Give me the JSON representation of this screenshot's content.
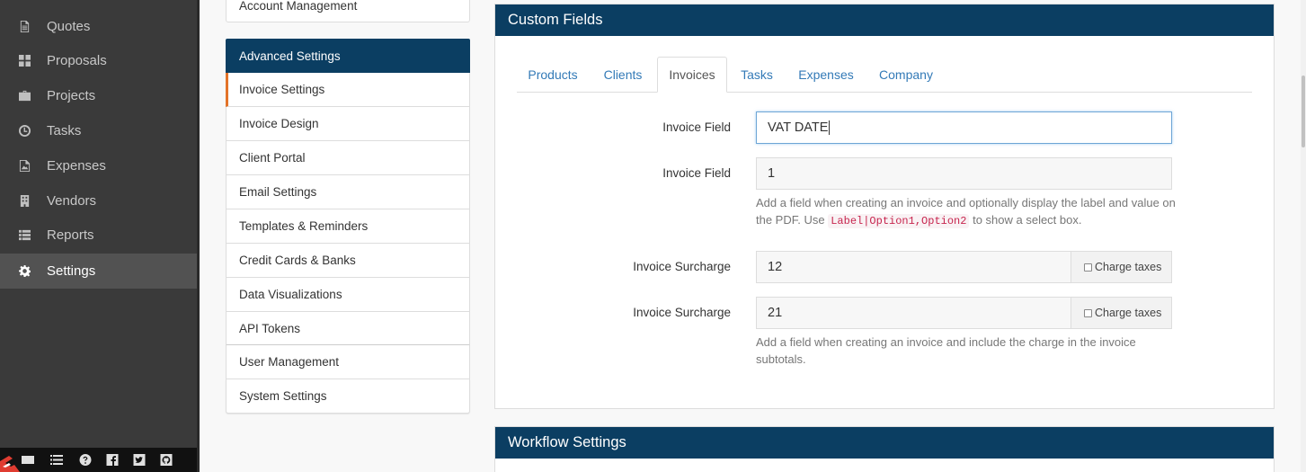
{
  "sidebar": {
    "items": [
      {
        "label": "Quotes",
        "icon": "file-icon"
      },
      {
        "label": "Proposals",
        "icon": "grid-icon"
      },
      {
        "label": "Projects",
        "icon": "briefcase-icon"
      },
      {
        "label": "Tasks",
        "icon": "clock-icon"
      },
      {
        "label": "Expenses",
        "icon": "image-icon"
      },
      {
        "label": "Vendors",
        "icon": "building-icon"
      },
      {
        "label": "Reports",
        "icon": "list-icon"
      },
      {
        "label": "Settings",
        "icon": "gear-icon",
        "active": true
      }
    ],
    "footer_icons": [
      "mail-icon",
      "list-icon",
      "help-icon",
      "facebook-icon",
      "twitter-icon",
      "github-icon"
    ]
  },
  "settings_nav": {
    "account_management": "Account Management",
    "advanced_header": "Advanced Settings",
    "items": [
      "Invoice Settings",
      "Invoice Design",
      "Client Portal",
      "Email Settings",
      "Templates & Reminders",
      "Credit Cards & Banks",
      "Data Visualizations",
      "API Tokens"
    ],
    "selected": "Invoice Settings",
    "admin_items": [
      "User Management",
      "System Settings"
    ]
  },
  "custom_fields": {
    "title": "Custom Fields",
    "tabs": [
      "Products",
      "Clients",
      "Invoices",
      "Tasks",
      "Expenses",
      "Company"
    ],
    "active_tab": "Invoices",
    "invoice_field_label_1": "Invoice Field",
    "invoice_field_value_1": "VAT DATE",
    "invoice_field_label_2": "Invoice Field",
    "invoice_field_value_2": "1",
    "invoice_field_help_prefix": "Add a field when creating an invoice and optionally display the label and value on the PDF. Use",
    "invoice_field_help_code": "Label|Option1,Option2",
    "invoice_field_help_suffix": "to show a select box.",
    "surcharge_label_1": "Invoice Surcharge",
    "surcharge_value_1": "12",
    "surcharge_label_2": "Invoice Surcharge",
    "surcharge_value_2": "21",
    "charge_taxes_label": "Charge taxes",
    "surcharge_help": "Add a field when creating an invoice and include the charge in the invoice subtotals."
  },
  "workflow": {
    "title": "Workflow Settings"
  },
  "colors": {
    "header_navy": "#0b3e62",
    "sidebar_dark": "#3a3a3a",
    "accent_orange": "#e37329",
    "link_blue": "#337ab7"
  }
}
